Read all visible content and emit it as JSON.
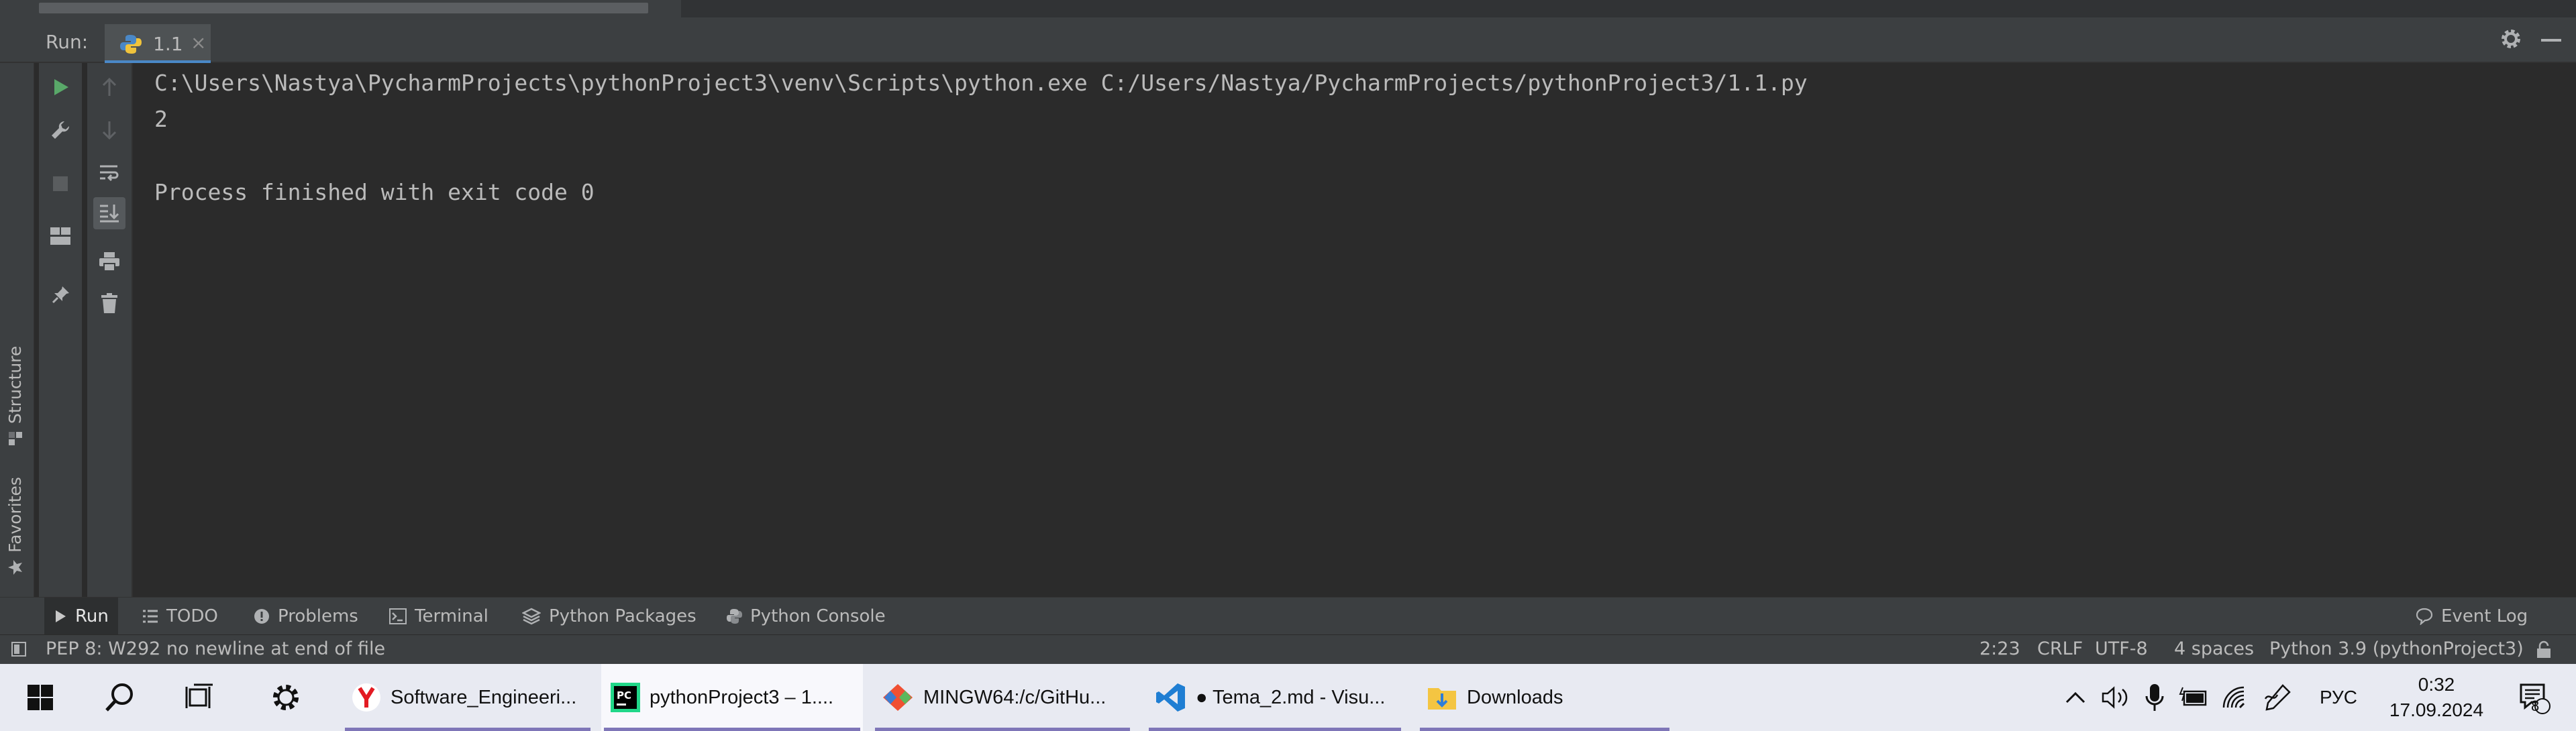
{
  "run_panel": {
    "label": "Run:",
    "tab_name": "1.1",
    "tab_close": "×"
  },
  "console": {
    "lines": [
      "C:\\Users\\Nastya\\PycharmProjects\\pythonProject3\\venv\\Scripts\\python.exe C:/Users/Nastya/PycharmProjects/pythonProject3/1.1.py",
      "2",
      "",
      "Process finished with exit code 0"
    ]
  },
  "side_tabs": {
    "structure": "Structure",
    "favorites": "Favorites"
  },
  "tool_tabs": [
    "Run",
    "TODO",
    "Problems",
    "Terminal",
    "Python Packages",
    "Python Console"
  ],
  "event_log": "Event Log",
  "status": {
    "message": "PEP 8: W292 no newline at end of file",
    "position": "2:23",
    "line_sep": "CRLF",
    "encoding": "UTF-8",
    "indent": "4 spaces",
    "interpreter": "Python 3.9 (pythonProject3)"
  },
  "taskbar": {
    "tasks": [
      "Software_Engineeri...",
      "pythonProject3 – 1....",
      "MINGW64:/c/GitHu...",
      "● Tema_2.md - Visu...",
      "Downloads"
    ],
    "language": "РУС",
    "time": "0:32",
    "date": "17.09.2024",
    "notifications": "8"
  },
  "colors": {
    "run_green": "#59a869",
    "accent_blue": "#4a88c7",
    "taskbar_underline": "#7f76b8"
  },
  "icons": [
    "python-file-icon",
    "gear-icon",
    "minimize-icon",
    "rerun-icon",
    "wrench-icon",
    "stop-icon",
    "layout-icon",
    "pin-icon",
    "up-arrow-icon",
    "down-arrow-icon",
    "soft-wrap-icon",
    "scroll-to-end-icon",
    "print-icon",
    "trash-icon",
    "windows-start-icon",
    "search-icon",
    "task-view-icon",
    "settings-icon",
    "yandex-browser-icon",
    "pycharm-icon",
    "git-icon",
    "vscode-icon",
    "folder-icon",
    "chevron-up-icon",
    "speaker-icon",
    "microphone-icon",
    "battery-icon",
    "wifi-icon",
    "pen-icon",
    "notification-icon"
  ]
}
